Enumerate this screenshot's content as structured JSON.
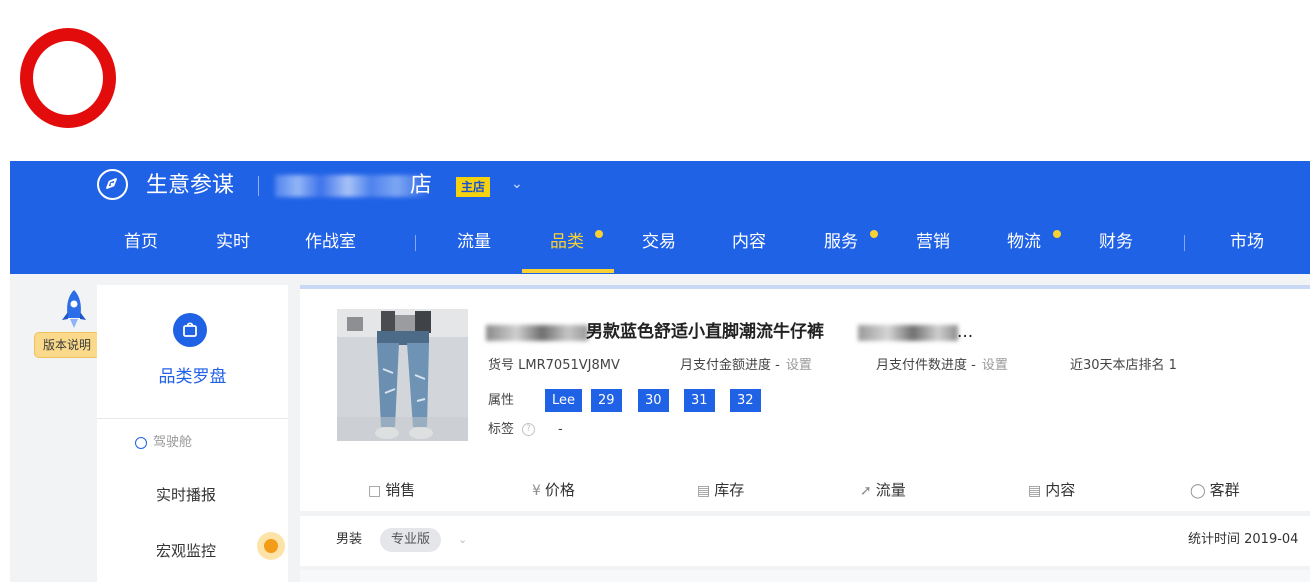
{
  "header": {
    "app_name": "生意参谋",
    "shop_name_tail": "店",
    "shop_badge": "主店",
    "shop_chevron_icon": "chevron-down-icon",
    "accent_color": "#2062e6",
    "highlight_color": "#f7d232"
  },
  "nav": {
    "items": [
      {
        "label": "首页"
      },
      {
        "label": "实时"
      },
      {
        "label": "作战室"
      },
      {
        "label": "流量"
      },
      {
        "label": "品类",
        "active": true,
        "dot": true
      },
      {
        "label": "交易"
      },
      {
        "label": "内容"
      },
      {
        "label": "服务",
        "dot": true
      },
      {
        "label": "营销"
      },
      {
        "label": "物流",
        "dot": true
      },
      {
        "label": "财务"
      },
      {
        "label": "市场"
      }
    ]
  },
  "version_badge": "版本说明",
  "sidebar": {
    "title": "品类罗盘",
    "title_icon": "shopping-bag-icon",
    "section": "驾驶舱",
    "items": [
      {
        "label": "实时播报"
      },
      {
        "label": "宏观监控"
      }
    ]
  },
  "product": {
    "title": "男款蓝色舒适小直脚潮流牛仔裤",
    "title_suffix": "...",
    "sku_label": "货号",
    "sku": "LMR7051VJ8MV",
    "monthly_amount_label": "月支付金额进度 -",
    "monthly_amount_link": "设置",
    "monthly_count_label": "月支付件数进度 -",
    "monthly_count_link": "设置",
    "rank_text": "近30天本店排名 1",
    "attr_label": "属性",
    "attributes": [
      "Lee",
      "29",
      "30",
      "31",
      "32"
    ],
    "tag_label": "标签",
    "tag_value": "-"
  },
  "tabs": [
    {
      "label": "销售",
      "icon": "bag-icon"
    },
    {
      "label": "价格",
      "icon": "yen-icon"
    },
    {
      "label": "库存",
      "icon": "warehouse-icon"
    },
    {
      "label": "流量",
      "icon": "line-chart-icon"
    },
    {
      "label": "内容",
      "icon": "document-icon"
    },
    {
      "label": "客群",
      "icon": "users-icon"
    }
  ],
  "bottom": {
    "category": "男装",
    "edition": "专业版",
    "stat_time": "统计时间 2019-04"
  }
}
